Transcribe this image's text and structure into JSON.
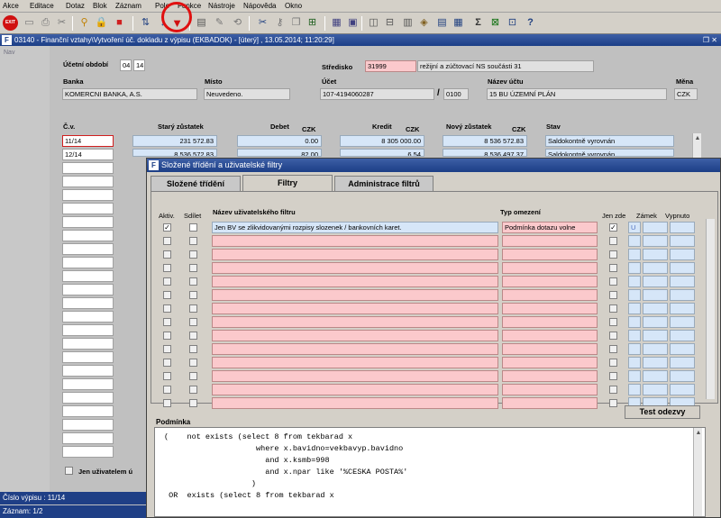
{
  "menu": [
    "Akce",
    "Editace",
    "Dotaz",
    "Blok",
    "Záznam",
    "Pole",
    "Funkce",
    "Nástroje",
    "Nápověda",
    "Okno"
  ],
  "toolbar": {
    "exit_label": "EXIT",
    "icons": [
      "exit-icon",
      "save-icon",
      "print-icon",
      "cut-icon",
      "search-icon",
      "lock-icon",
      "unlock-icon",
      "sort-asc-icon",
      "sort-desc-icon",
      "filter-icon",
      "document-icon",
      "edit-icon",
      "refresh-icon",
      "scissors-icon",
      "key-icon",
      "copy-icon",
      "network-icon",
      "calendar-icon",
      "calculator-icon",
      "package-icon",
      "grid-icon",
      "sigma-icon",
      "excel-icon",
      "help-icon",
      "question-icon"
    ]
  },
  "main": {
    "title": "03140 - Finanční vztahy\\Vytvoření úč. dokladu z výpisu (EKBADOK) - [úterý] , 13.05.2014; 11:20:29]",
    "nav_label": "Nav",
    "ucetni_obdobi_label": "Účetní období",
    "ucetni_obdobi_month": "04",
    "ucetni_obdobi_year": "14",
    "stredisko_label": "Středisko",
    "stredisko_code": "31999",
    "stredisko_name": "režijní a zúčtovací NS součásti 31",
    "banka_label": "Banka",
    "banka_value": "KOMERCNI BANKA, A.S.",
    "misto_label": "Místo",
    "misto_value": "Neuvedeno.",
    "ucet_label": "Účet",
    "ucet_value": "107-4194060287",
    "ucet_sep": "/",
    "ucet_bank": "0100",
    "nazev_uctu_label": "Název účtu",
    "nazev_uctu_value": "15 BU ÚZEMNÍ PLÁN",
    "mena_label": "Měna",
    "mena_value": "CZK",
    "cv_label": "Č.v.",
    "stary_label": "Starý zůstatek",
    "debet_label": "Debet",
    "debet_cur": "CZK",
    "kredit_label": "Kredit",
    "kredit_cur": "CZK",
    "novy_label": "Nový zůstatek",
    "novy_cur": "CZK",
    "stav_label": "Stav",
    "rows": [
      {
        "cv": "11/14",
        "stary": "231 572.83",
        "debet": "0.00",
        "kredit": "8 305 000.00",
        "novy": "8 536 572.83",
        "stav": "Saldokontně vyrovnán"
      },
      {
        "cv": "12/14",
        "stary": "8 536 572.83",
        "debet": "82.00",
        "kredit": "6.54",
        "novy": "8 536 497.37",
        "stav": "Saldokontně vyrovnán"
      }
    ],
    "only_user_label": "Jen uživatelem ú"
  },
  "status": {
    "line1": "Číslo výpisu : 11/14",
    "line2": "Záznam: 1/2"
  },
  "dialog": {
    "title": "Složené třídění a uživatelské filtry",
    "tabs": [
      "Složené třídění",
      "Filtry",
      "Administrace filtrů"
    ],
    "active_tab": 1,
    "col_aktiv": "Aktiv.",
    "col_sdilet": "Sdílet",
    "col_nazev": "Název uživatelského filtru",
    "col_typ": "Typ omezení",
    "col_jen_zde": "Jen zde",
    "col_zamek": "Zámek",
    "col_vypnuto": "Vypnuto",
    "filter_rows": [
      {
        "nazev": "Jen BV se zlikvidovanými rozpisy slozenek / bankovních karet.",
        "typ": "Podmínka dotazu volne",
        "zamek": "U",
        "aktiv": true,
        "jen_zde": true
      }
    ],
    "test_button": "Test odezvy",
    "podminka_label": "Podmínka",
    "podminka_text": "(    not exists (select 8 from tekbarad x\n                    where x.bavidno=vekbavyp.bavidno\n                      and x.ksmb=998\n                      and x.npar like '%CESKA POSTA%'\n                   )\n OR  exists (select 8 from tekbarad x"
  },
  "colors": {
    "title_bar": "#1c3e86",
    "field_blue": "#d6e6f8",
    "field_pink": "#fbc9cc",
    "highlight_red": "#e01010"
  }
}
